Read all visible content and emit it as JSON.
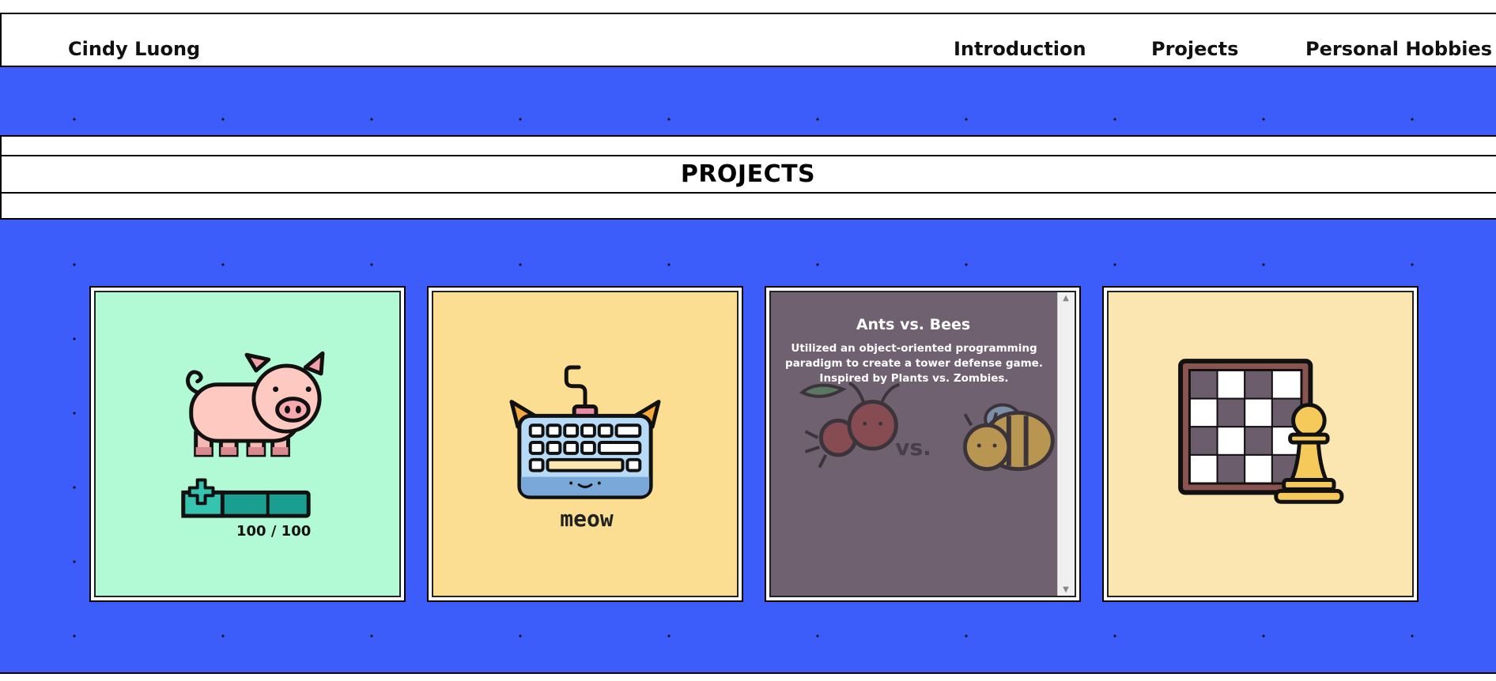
{
  "header": {
    "brand": "Cindy Luong",
    "nav": [
      "Introduction",
      "Projects",
      "Personal Hobbies"
    ]
  },
  "section": {
    "title": "PROJECTS"
  },
  "cards": [
    {
      "icon": "pig-health-bar-icon",
      "hp_text": "100 / 100",
      "bg": "#b2f9d6"
    },
    {
      "icon": "cat-keyboard-icon",
      "label": "meow",
      "bg": "#fbde92"
    },
    {
      "icon": "ants-vs-bees-icon",
      "title": "Ants vs. Bees",
      "description": "Utilized an object-oriented programming paradigm to create a tower defense game. Inspired by Plants vs. Zombies.",
      "vs": "vs.",
      "bg": "#6f6170"
    },
    {
      "icon": "chessboard-pawn-icon",
      "bg": "#fbe6b2"
    }
  ],
  "colors": {
    "band": "#3d5dfa"
  }
}
